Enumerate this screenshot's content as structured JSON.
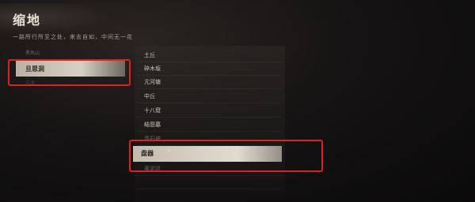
{
  "header": {
    "title": "缩地",
    "subtitle": "一路所行所至之处，来去自如，中间无一花"
  },
  "regions": {
    "group_label": "黑风山",
    "items": [
      {
        "label": "旦思洞",
        "selected": true
      }
    ],
    "sub_label": "亢龙"
  },
  "locations": [
    {
      "label": "土丘",
      "state": "normal"
    },
    {
      "label": "碎木坂",
      "state": "normal"
    },
    {
      "label": "亢河塘",
      "state": "normal"
    },
    {
      "label": "中丘",
      "state": "normal"
    },
    {
      "label": "十八窟",
      "state": "normal"
    },
    {
      "label": "结怨墓",
      "state": "normal"
    },
    {
      "label": "青石坡",
      "state": "dim"
    },
    {
      "label": "盘器",
      "state": "selected"
    },
    {
      "label": "黄泥坑",
      "state": "dim"
    },
    {
      "label": "",
      "state": "dim"
    }
  ],
  "colors": {
    "highlight": "#e0201c",
    "selected_bar": "#dcd5c6",
    "background": "#121010"
  }
}
